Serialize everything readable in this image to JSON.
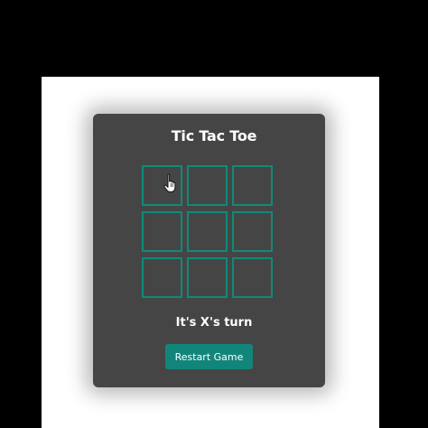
{
  "game": {
    "title": "Tic Tac Toe",
    "status": "It's X's turn",
    "restart_label": "Restart Game",
    "cells": [
      "",
      "",
      "",
      "",
      "",
      "",
      "",
      "",
      ""
    ]
  },
  "cursor": {
    "icon": "hand-pointer-icon"
  },
  "colors": {
    "page_background": "#000000",
    "viewport_background": "#ffffff",
    "card_background": "#454545",
    "cell_border": "#0f8a7a",
    "button_background": "#12857a",
    "text": "#ffffff"
  }
}
